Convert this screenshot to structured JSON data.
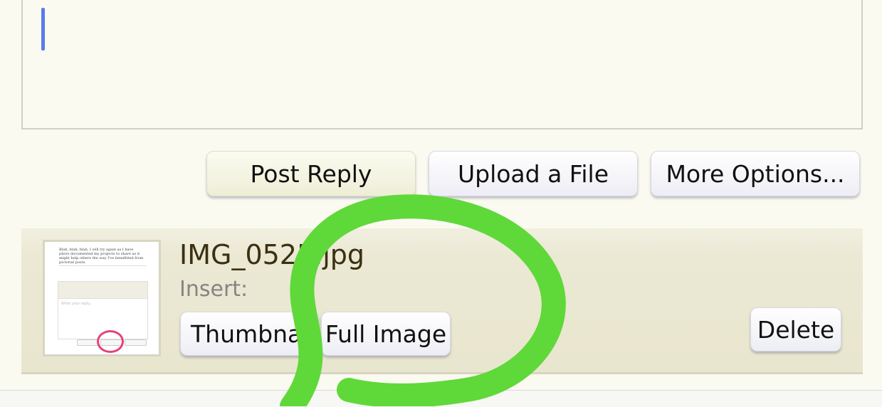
{
  "reply_editor": {
    "content": ""
  },
  "toolbar": {
    "post_reply_label": "Post Reply",
    "upload_file_label": "Upload a File",
    "more_options_label": "More Options..."
  },
  "attachment": {
    "file_name": "IMG_0525.jpg",
    "insert_label": "Insert:",
    "thumbnail_button_label": "Thumbnail",
    "full_image_button_label": "Full Image",
    "delete_button_label": "Delete",
    "thumbnail_preview": {
      "text": "Blah, blah, blah, I will try again as I have photo documented my projects to share as it might help others the way I've benefitted from pictorial posts.",
      "editor_placeholder": "Write your reply..."
    }
  },
  "annotation": {
    "color": "#5fd83a"
  }
}
